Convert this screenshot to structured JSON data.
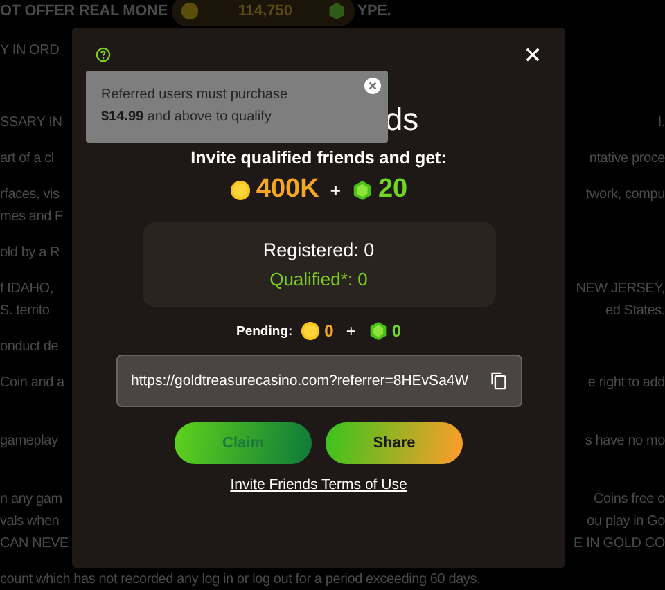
{
  "top_bar": {
    "left": "OT OFFER REAL MONE",
    "balance": "114,750",
    "right": "YPE."
  },
  "background_lines": [
    {
      "kind": "para",
      "left": "Y IN ORD"
    },
    {
      "kind": "section",
      "left": "SSARY IN",
      "right": "I."
    },
    {
      "kind": "para",
      "left": "art of a cl",
      "right": "ntative proce"
    },
    {
      "kind": "para",
      "left": "rfaces, vis",
      "right": "twork, compu"
    },
    {
      "kind": "cont",
      "left": "mes and F"
    },
    {
      "kind": "para",
      "left": "old by a R"
    },
    {
      "kind": "para",
      "left": "f IDAHO,",
      "right": "NEW JERSEY,"
    },
    {
      "kind": "cont",
      "left": "S. territo",
      "right": "ed States."
    },
    {
      "kind": "para",
      "left": "onduct de"
    },
    {
      "kind": "para",
      "left": "Coin and a",
      "right": "e right to add"
    },
    {
      "kind": "wide",
      "left": "gameplay",
      "right": "s have no mo"
    },
    {
      "kind": "wide",
      "left": "n any gam",
      "right": "Coins free o"
    },
    {
      "kind": "cont",
      "left": "vals when",
      "right": "ou play in Go"
    },
    {
      "kind": "cont",
      "left": "CAN NEVE",
      "right": "E IN GOLD CO"
    },
    {
      "kind": "para",
      "left": "count which has not recorded any log in or log out for a period exceeding 60 days."
    }
  ],
  "modal": {
    "title": "ds",
    "tooltip": {
      "text": "Referred users must purchase **$14.99** and above to qualify"
    },
    "subtitle": "Invite qualified friends and get:",
    "reward": {
      "coins": "400K",
      "plus": "+",
      "gems": "20"
    },
    "stats": {
      "registered": "Registered: 0",
      "qualified": "Qualified*: 0"
    },
    "pending": {
      "label": "Pending:",
      "coins": "0",
      "plus": "+",
      "gems": "0"
    },
    "link": "https://goldtreasurecasino.com?referrer=8HEvSa4W",
    "buttons": [
      {
        "label": "Claim",
        "kind": "claim",
        "disabled": true
      },
      {
        "label": "Share",
        "kind": "share",
        "disabled": false
      }
    ],
    "terms": "Invite Friends Terms of Use"
  }
}
